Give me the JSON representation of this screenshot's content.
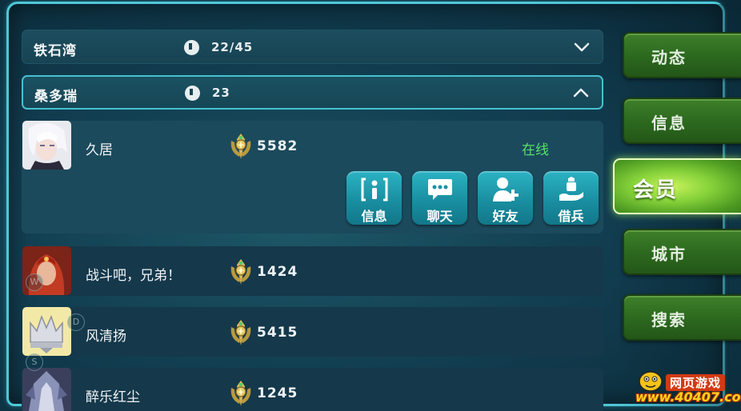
{
  "guilds": [
    {
      "name": "铁石湾",
      "count": "22/45",
      "expanded": false
    },
    {
      "name": "桑多瑞",
      "count": "23",
      "expanded": true
    }
  ],
  "members": [
    {
      "name": "久居",
      "score": "5582",
      "status": "在线",
      "avatar": "white-hair-avatar"
    },
    {
      "name": "战斗吧，兄弟！",
      "score": "1424",
      "avatar": "red-warrior-avatar"
    },
    {
      "name": "风清扬",
      "score": "5415",
      "avatar": "crown-avatar"
    },
    {
      "name": "醉乐红尘",
      "score": "1245",
      "avatar": "armored-knight-avatar"
    }
  ],
  "actions": [
    {
      "label": "信息",
      "icon": "info-icon"
    },
    {
      "label": "聊天",
      "icon": "chat-icon"
    },
    {
      "label": "好友",
      "icon": "add-friend-icon"
    },
    {
      "label": "借兵",
      "icon": "borrow-troops-icon"
    }
  ],
  "tabs": [
    {
      "label": "动态",
      "active": false
    },
    {
      "label": "信息",
      "active": false
    },
    {
      "label": "会员",
      "active": true
    },
    {
      "label": "城市",
      "active": false
    },
    {
      "label": "搜索",
      "active": false
    }
  ],
  "controls": [
    "W",
    "D",
    "S"
  ],
  "watermark": {
    "title": "网页游戏",
    "url": "www.40407.com"
  },
  "colors": {
    "panel_border": "#4fc7d8",
    "online": "#59e06a",
    "tab_green": "#2d6a1f",
    "tab_active": "#86d23a",
    "action_btn": "#198fa1"
  }
}
